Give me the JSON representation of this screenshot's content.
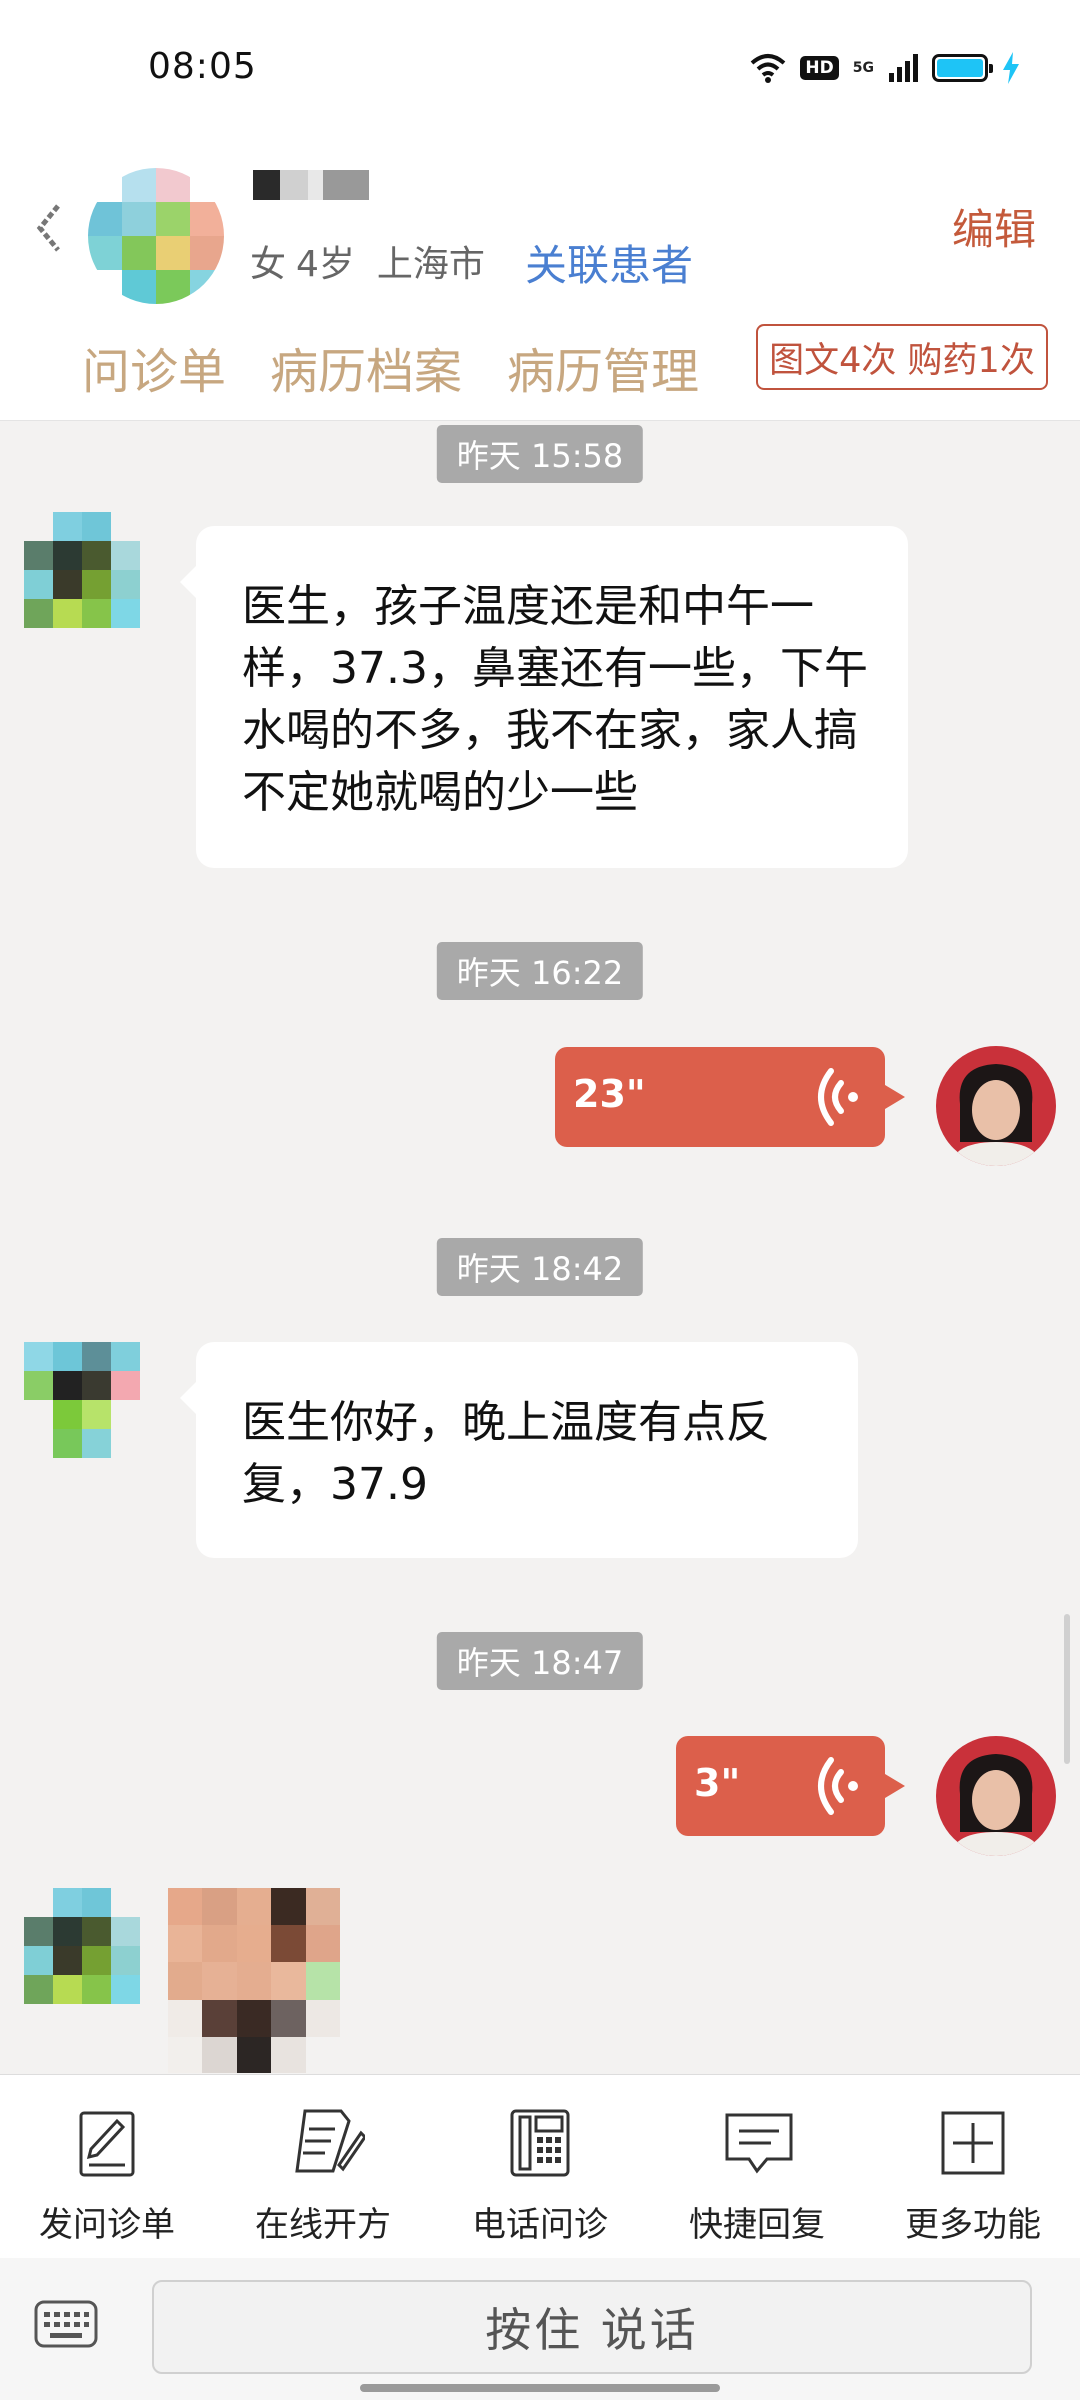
{
  "status_bar": {
    "time": "08:05",
    "network": "5G",
    "hd_label": "HD",
    "battery_color": "#1ec4f6"
  },
  "header": {
    "patient_info": {
      "gender": "女",
      "age": "4岁",
      "city": "上海市"
    },
    "link_patient_label": "关联患者",
    "edit_label": "编辑",
    "tabs": [
      "问诊单",
      "病历档案",
      "病历管理"
    ],
    "stats_badge": "图文4次 购药1次",
    "accent_color": "#c7a780"
  },
  "chat": {
    "messages": [
      {
        "timestamp": "昨天 15:58",
        "sender": "patient",
        "type": "text",
        "text": "医生，孩子温度还是和中午一样，37.3，鼻塞还有一些，下午水喝的不多，我不在家，家人搞不定她就喝的少一些"
      },
      {
        "timestamp": "昨天 16:22",
        "sender": "doctor",
        "type": "voice",
        "duration": "23\""
      },
      {
        "timestamp": "昨天 18:42",
        "sender": "patient",
        "type": "text",
        "text": "医生你好，晚上温度有点反复，37.9"
      },
      {
        "timestamp": "昨天 18:47",
        "sender": "doctor",
        "type": "voice",
        "duration": "3\""
      },
      {
        "sender": "patient",
        "type": "image"
      }
    ]
  },
  "toolbar": {
    "items": [
      {
        "label": "发问诊单",
        "icon": "form-edit-icon"
      },
      {
        "label": "在线开方",
        "icon": "prescription-icon"
      },
      {
        "label": "电话问诊",
        "icon": "phone-icon"
      },
      {
        "label": "快捷回复",
        "icon": "quick-reply-icon"
      },
      {
        "label": "更多功能",
        "icon": "plus-box-icon"
      }
    ]
  },
  "input_bar": {
    "hold_to_talk_label": "按住 说话"
  },
  "colors": {
    "voice_bubble": "#dc5f4b",
    "link": "#4a7fd1",
    "edit": "#c45a3b"
  }
}
